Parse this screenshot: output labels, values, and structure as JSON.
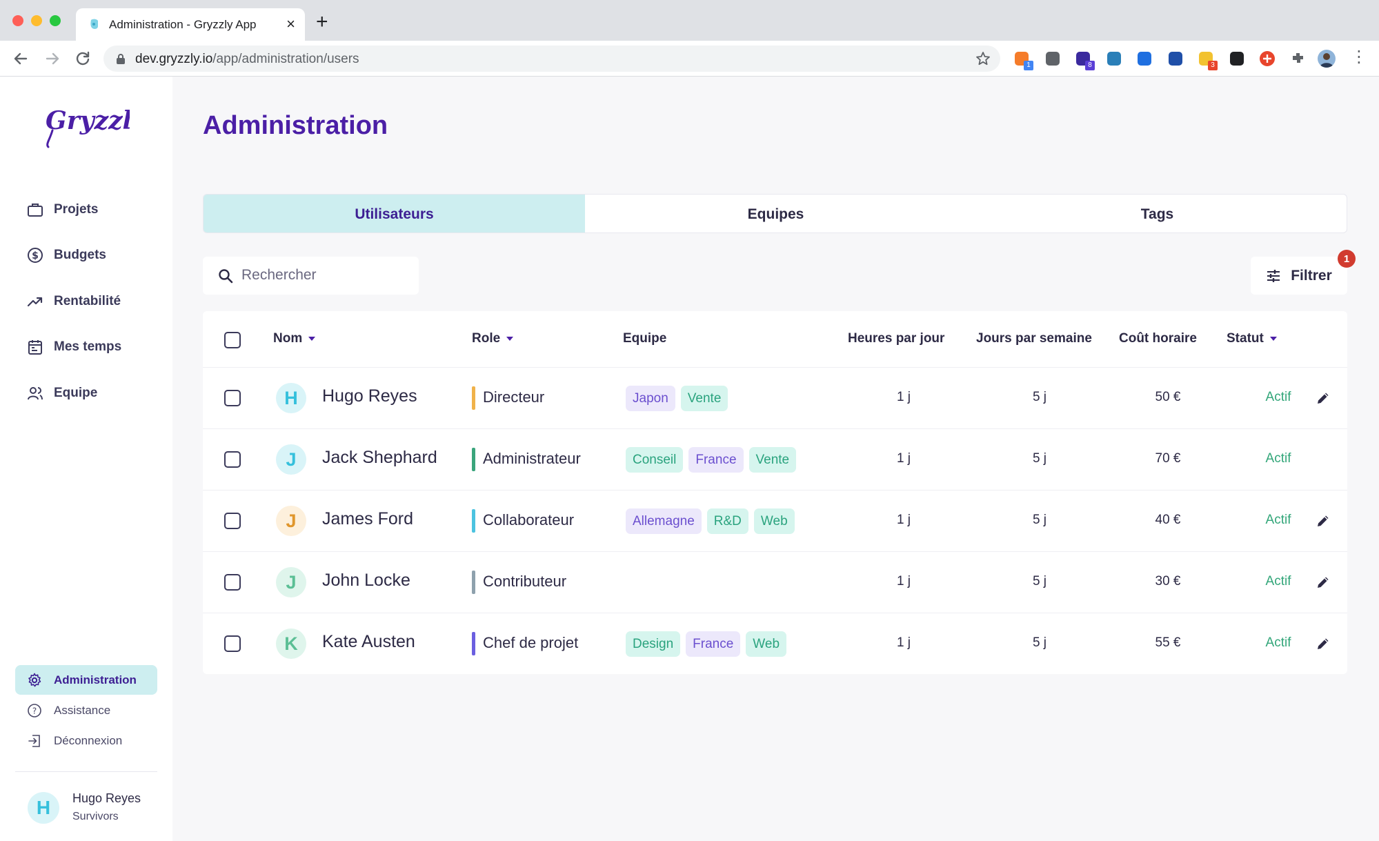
{
  "browser": {
    "tab_title": "Administration - Gryzzly App",
    "url_host": "dev.gryzzly.io",
    "url_path": "/app/administration/users",
    "extensions": [
      {
        "icon": "hubspot-ext-icon",
        "badge": "1",
        "badge_color": "#4285f4"
      },
      {
        "icon": "ublock-ext-icon",
        "badge": ""
      },
      {
        "icon": "graduation-cap-ext-icon",
        "badge": "8",
        "badge_color": "#5b3fd6"
      },
      {
        "icon": "n-scanner-ext-icon",
        "badge": ""
      },
      {
        "icon": "onepassword-ext-icon",
        "badge": ""
      },
      {
        "icon": "y-ext-icon",
        "badge": ""
      },
      {
        "icon": "lightbulb-ext-icon",
        "badge": "3",
        "badge_color": "#e8452c"
      },
      {
        "icon": "buffer-ext-icon",
        "badge": ""
      },
      {
        "icon": "plus-circle-ext-icon",
        "badge": ""
      },
      {
        "icon": "puzzle-ext-icon",
        "badge": ""
      }
    ]
  },
  "sidebar": {
    "brand": "Gryzzly",
    "nav": [
      {
        "label": "Projets",
        "icon": "briefcase-icon"
      },
      {
        "label": "Budgets",
        "icon": "dollar-circle-icon"
      },
      {
        "label": "Rentabilité",
        "icon": "trend-up-icon"
      },
      {
        "label": "Mes temps",
        "icon": "calendar-icon"
      },
      {
        "label": "Equipe",
        "icon": "users-icon"
      }
    ],
    "bottom_nav": [
      {
        "label": "Administration",
        "icon": "gear-icon",
        "active": true
      },
      {
        "label": "Assistance",
        "icon": "help-circle-icon",
        "active": false
      },
      {
        "label": "Déconnexion",
        "icon": "logout-icon",
        "active": false
      }
    ],
    "user": {
      "initial": "H",
      "name": "Hugo Reyes",
      "team": "Survivors"
    }
  },
  "main": {
    "title": "Administration",
    "tabs": [
      {
        "label": "Utilisateurs",
        "active": true
      },
      {
        "label": "Equipes",
        "active": false
      },
      {
        "label": "Tags",
        "active": false
      }
    ],
    "search_placeholder": "Rechercher",
    "filter_label": "Filtrer",
    "filter_count": "1"
  },
  "table": {
    "columns": {
      "name": "Nom",
      "role": "Role",
      "team": "Equipe",
      "hours": "Heures par jour",
      "days": "Jours par semaine",
      "cost": "Coût horaire",
      "status": "Statut"
    },
    "rows": [
      {
        "initial": "H",
        "name": "Hugo Reyes",
        "avatar_bg": "#d9f4f8",
        "avatar_fg": "#35c0dc",
        "role": "Directeur",
        "role_color": "#f0b24a",
        "tags": [
          {
            "label": "Japon",
            "color": "purple"
          },
          {
            "label": "Vente",
            "color": "green"
          }
        ],
        "hours": "1 j",
        "days": "5 j",
        "cost": "50 €",
        "status": "Actif",
        "editable": true
      },
      {
        "initial": "J",
        "name": "Jack Shephard",
        "avatar_bg": "#d9f4f8",
        "avatar_fg": "#35c0dc",
        "role": "Administrateur",
        "role_color": "#3aa57c",
        "tags": [
          {
            "label": "Conseil",
            "color": "green"
          },
          {
            "label": "France",
            "color": "purple"
          },
          {
            "label": "Vente",
            "color": "green"
          }
        ],
        "hours": "1 j",
        "days": "5 j",
        "cost": "70 €",
        "status": "Actif",
        "editable": false
      },
      {
        "initial": "J",
        "name": "James Ford",
        "avatar_bg": "#fdf0dc",
        "avatar_fg": "#e0962c",
        "role": "Collaborateur",
        "role_color": "#4cc3e0",
        "tags": [
          {
            "label": "Allemagne",
            "color": "purple"
          },
          {
            "label": "R&D",
            "color": "green"
          },
          {
            "label": "Web",
            "color": "green"
          }
        ],
        "hours": "1 j",
        "days": "5 j",
        "cost": "40 €",
        "status": "Actif",
        "editable": true
      },
      {
        "initial": "J",
        "name": "John Locke",
        "avatar_bg": "#dff5ec",
        "avatar_fg": "#5bbf95",
        "role": "Contributeur",
        "role_color": "#8ea1ad",
        "tags": [],
        "hours": "1 j",
        "days": "5 j",
        "cost": "30 €",
        "status": "Actif",
        "editable": true
      },
      {
        "initial": "K",
        "name": "Kate Austen",
        "avatar_bg": "#dff5ec",
        "avatar_fg": "#5bbf95",
        "role": "Chef de projet",
        "role_color": "#6b5fe0",
        "tags": [
          {
            "label": "Design",
            "color": "green"
          },
          {
            "label": "France",
            "color": "purple"
          },
          {
            "label": "Web",
            "color": "green"
          }
        ],
        "hours": "1 j",
        "days": "5 j",
        "cost": "55 €",
        "status": "Actif",
        "editable": true
      }
    ]
  }
}
